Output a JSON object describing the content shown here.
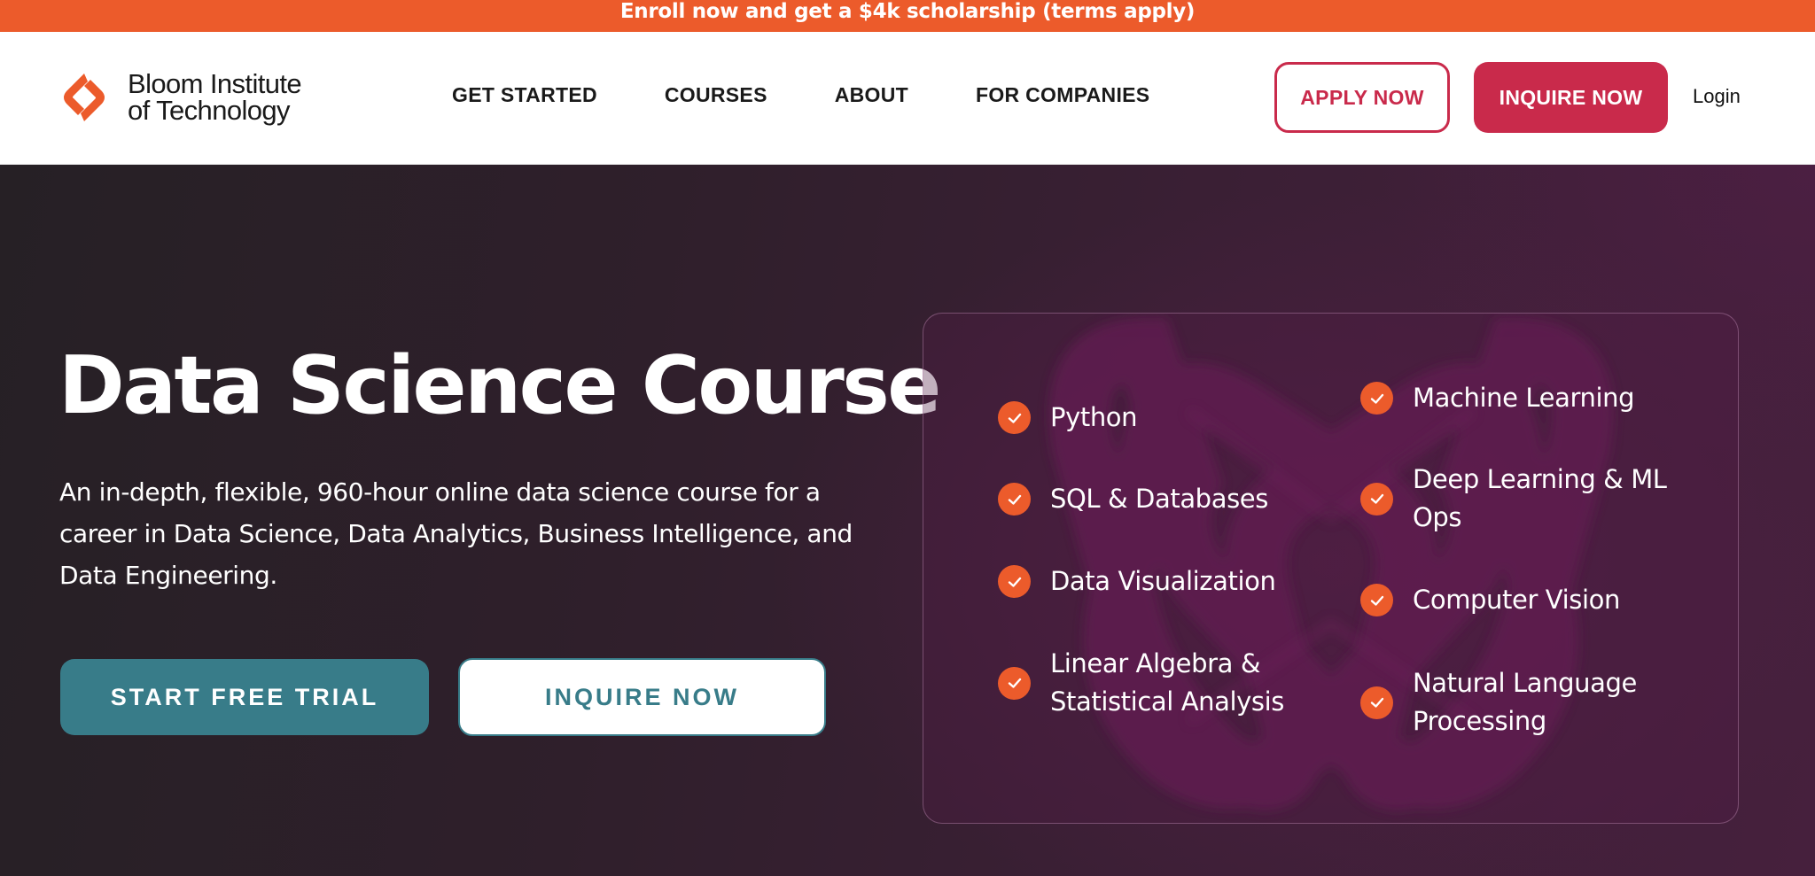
{
  "promo": {
    "text": "Enroll now and get a $4k scholarship (terms apply)"
  },
  "header": {
    "logo": {
      "icon": "bloom-logo-icon",
      "line1": "Bloom Institute",
      "line2": "of Technology"
    },
    "nav": [
      {
        "label": "GET STARTED"
      },
      {
        "label": "COURSES"
      },
      {
        "label": "ABOUT"
      },
      {
        "label": "FOR COMPANIES"
      }
    ],
    "apply_label": "APPLY NOW",
    "inquire_label": "INQUIRE NOW",
    "login_label": "Login"
  },
  "hero": {
    "title": "Data Science Course",
    "description": "An in-depth, flexible, 960-hour online data science course for a career in Data Science, Data Analytics, Business Intelligence, and Data Engineering.",
    "trial_label": "START FREE TRIAL",
    "inquire_label": "INQUIRE NOW"
  },
  "features": {
    "icon": "check-circle-icon",
    "left": [
      {
        "label": "Python"
      },
      {
        "label": "SQL & Databases"
      },
      {
        "label": "Data Visualization"
      },
      {
        "label": "Linear Algebra & Statistical Analysis"
      }
    ],
    "right": [
      {
        "label": "Machine Learning"
      },
      {
        "label": "Deep Learning & ML Ops"
      },
      {
        "label": "Computer Vision"
      },
      {
        "label": "Natural Language Processing"
      }
    ]
  },
  "colors": {
    "brand_orange": "#ec5b2b",
    "brand_red": "#c92a4b",
    "teal": "#387c89",
    "hero_bg": "#2c1f28"
  }
}
